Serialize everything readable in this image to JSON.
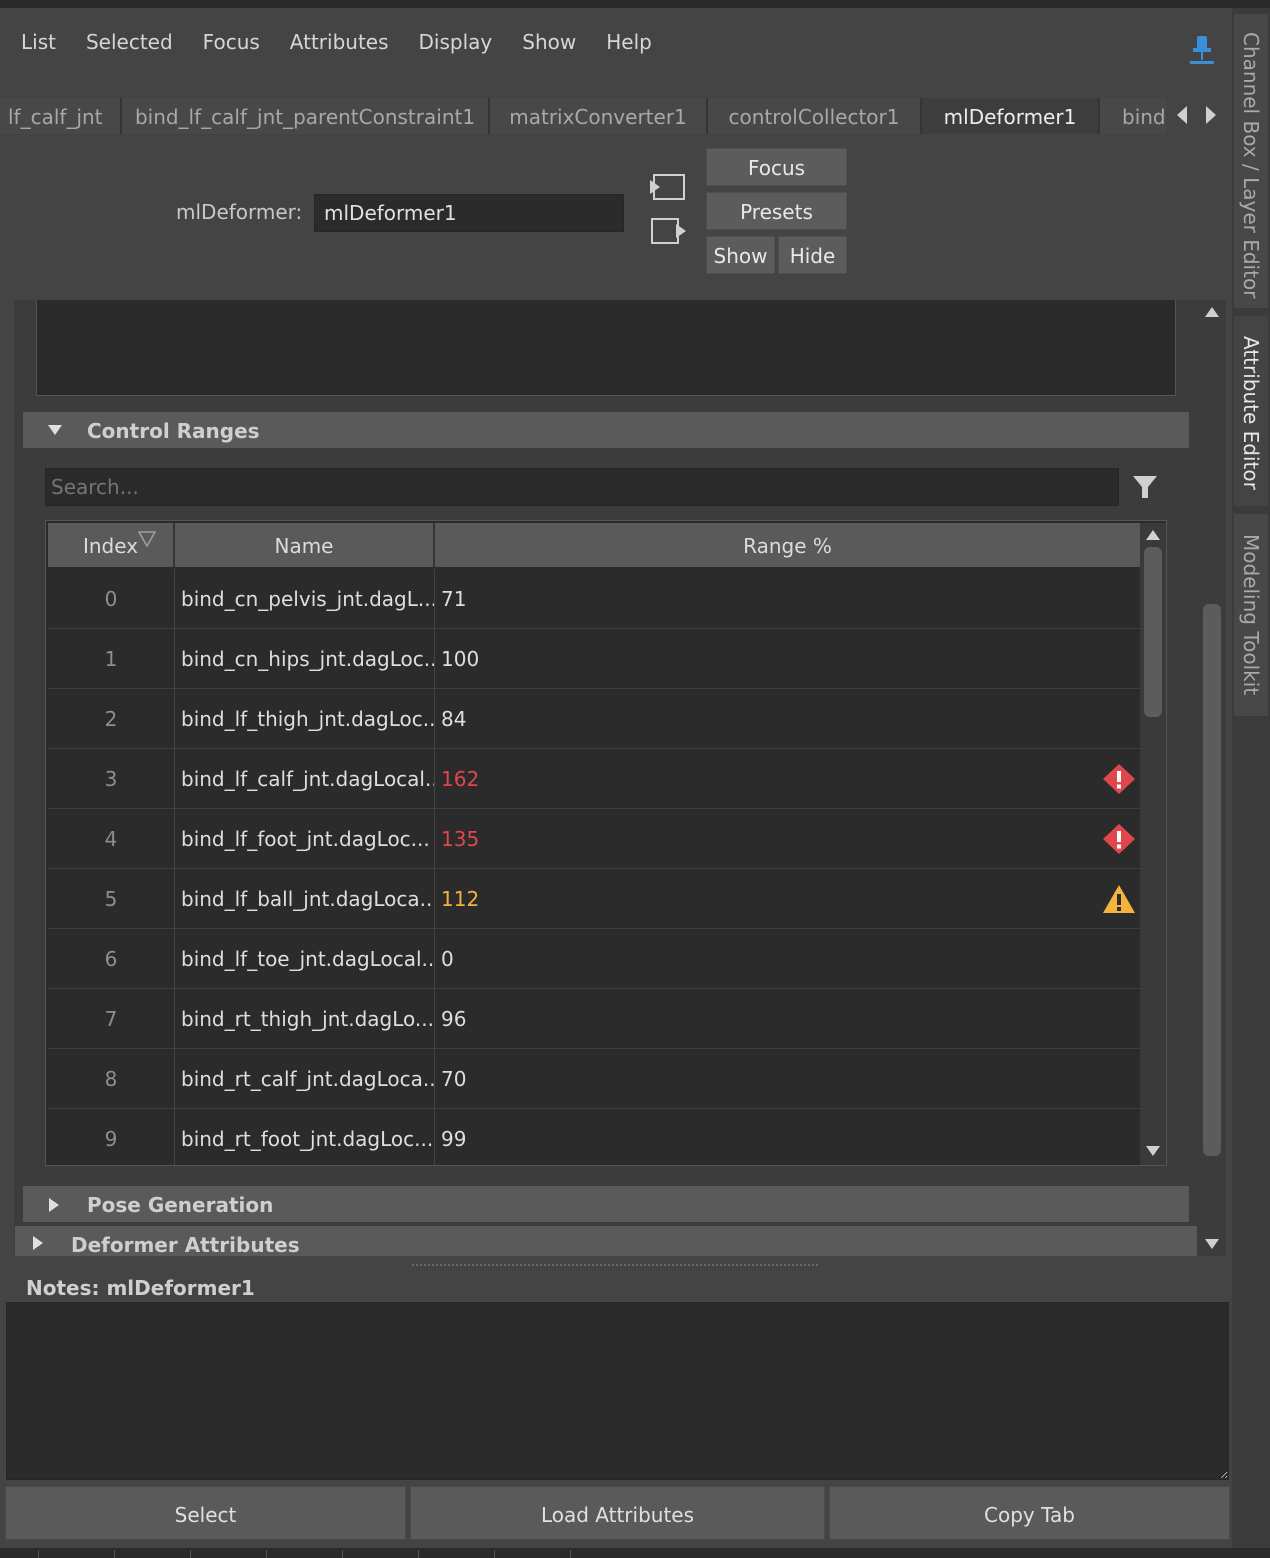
{
  "menubar": {
    "items": [
      "List",
      "Selected",
      "Focus",
      "Attributes",
      "Display",
      "Show",
      "Help"
    ]
  },
  "tabs": [
    {
      "label": "lf_calf_jnt",
      "active": false
    },
    {
      "label": "bind_lf_calf_jnt_parentConstraint1",
      "active": false
    },
    {
      "label": "matrixConverter1",
      "active": false
    },
    {
      "label": "controlCollector1",
      "active": false
    },
    {
      "label": "mlDeformer1",
      "active": true
    },
    {
      "label": "bind",
      "active": false
    }
  ],
  "node": {
    "type_label": "mlDeformer:",
    "name_value": "mlDeformer1"
  },
  "header_buttons": {
    "focus": "Focus",
    "presets": "Presets",
    "show": "Show",
    "hide": "Hide"
  },
  "sections": {
    "control_ranges": "Control Ranges",
    "pose_generation": "Pose Generation",
    "deformer_attributes": "Deformer Attributes"
  },
  "search": {
    "placeholder": "Search..."
  },
  "table": {
    "headers": [
      "Index",
      "Name",
      "Range %"
    ],
    "rows": [
      {
        "index": "0",
        "name": "bind_cn_pelvis_jnt.dagL...",
        "range": "71",
        "status": "ok"
      },
      {
        "index": "1",
        "name": "bind_cn_hips_jnt.dagLoc...",
        "range": "100",
        "status": "ok"
      },
      {
        "index": "2",
        "name": "bind_lf_thigh_jnt.dagLoc...",
        "range": "84",
        "status": "ok"
      },
      {
        "index": "3",
        "name": "bind_lf_calf_jnt.dagLocal...",
        "range": "162",
        "status": "error"
      },
      {
        "index": "4",
        "name": "bind_lf_foot_jnt.dagLoc...",
        "range": "135",
        "status": "error"
      },
      {
        "index": "5",
        "name": "bind_lf_ball_jnt.dagLoca...",
        "range": "112",
        "status": "warning"
      },
      {
        "index": "6",
        "name": "bind_lf_toe_jnt.dagLocal...",
        "range": "0",
        "status": "ok"
      },
      {
        "index": "7",
        "name": "bind_rt_thigh_jnt.dagLo...",
        "range": "96",
        "status": "ok"
      },
      {
        "index": "8",
        "name": "bind_rt_calf_jnt.dagLoca...",
        "range": "70",
        "status": "ok"
      },
      {
        "index": "9",
        "name": "bind_rt_foot_jnt.dagLoc...",
        "range": "99",
        "status": "ok"
      }
    ]
  },
  "notes": {
    "label": "Notes:  mlDeformer1"
  },
  "footer": {
    "select": "Select",
    "load_attributes": "Load Attributes",
    "copy_tab": "Copy Tab"
  },
  "side_tabs": [
    {
      "label": "Channel Box / Layer Editor",
      "active": false
    },
    {
      "label": "Attribute Editor",
      "active": true
    },
    {
      "label": "Modeling Toolkit",
      "active": false
    }
  ],
  "colors": {
    "error": "#e0474c",
    "warning": "#f3b33d",
    "pin": "#3a8fd8"
  }
}
